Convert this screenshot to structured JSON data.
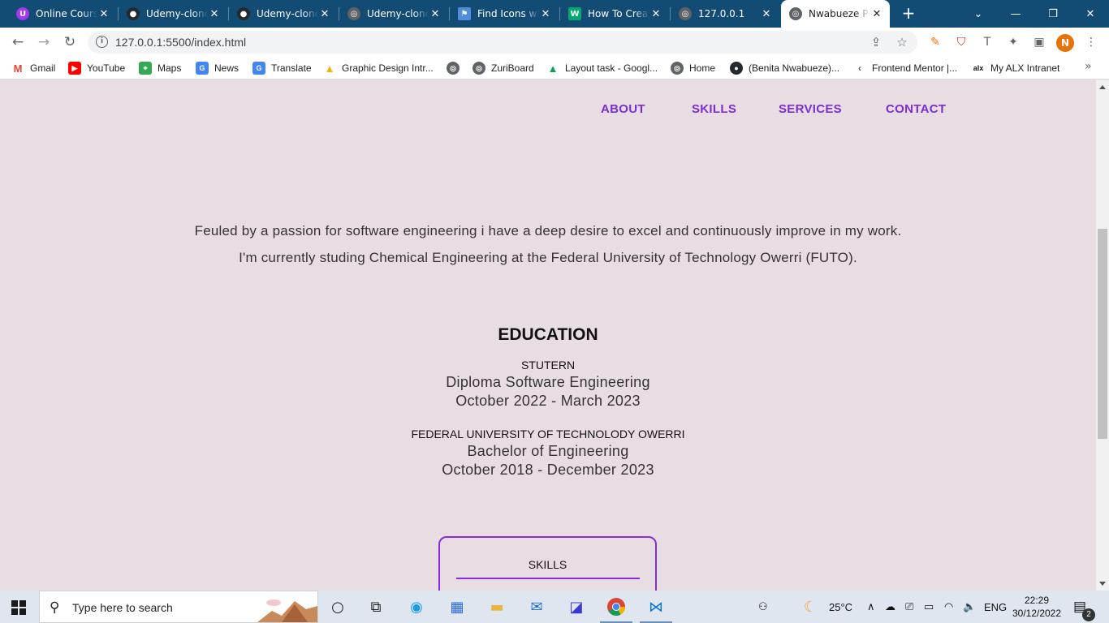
{
  "browser": {
    "tabs": [
      {
        "title": "Online Courses",
        "icon": "udemy-icon",
        "color": "#a435f0"
      },
      {
        "title": "Udemy-clone",
        "icon": "github-icon",
        "color": "#24292f"
      },
      {
        "title": "Udemy-clone",
        "icon": "github-icon",
        "color": "#24292f"
      },
      {
        "title": "Udemy-clone",
        "icon": "globe-icon",
        "color": "#5f6368"
      },
      {
        "title": "Find Icons with",
        "icon": "flag-icon",
        "color": "#528dd7"
      },
      {
        "title": "How To Create",
        "icon": "w-icon",
        "color": "#04aa6d"
      },
      {
        "title": "127.0.0.1",
        "icon": "globe-icon",
        "color": "#5f6368"
      },
      {
        "title": "Nwabueze Portfolio",
        "icon": "globe-icon",
        "color": "#5f6368",
        "active": true
      }
    ],
    "url": "127.0.0.1:5500/index.html",
    "profile_initial": "N",
    "bookmarks": [
      {
        "label": "Gmail",
        "icon": "gmail-icon"
      },
      {
        "label": "YouTube",
        "icon": "youtube-icon"
      },
      {
        "label": "Maps",
        "icon": "maps-icon"
      },
      {
        "label": "News",
        "icon": "news-icon"
      },
      {
        "label": "Translate",
        "icon": "translate-icon"
      },
      {
        "label": "Graphic Design Intr...",
        "icon": "graphic-design-icon"
      },
      {
        "label": "",
        "icon": "globe-icon"
      },
      {
        "label": "ZuriBoard",
        "icon": "globe-icon"
      },
      {
        "label": "Layout task - Googl...",
        "icon": "drive-icon"
      },
      {
        "label": "Home",
        "icon": "globe-icon"
      },
      {
        "label": "(Benita Nwabueze)...",
        "icon": "github-icon"
      },
      {
        "label": "Frontend Mentor |...",
        "icon": "frontend-mentor-icon"
      },
      {
        "label": "My ALX Intranet",
        "icon": "alx-icon"
      }
    ]
  },
  "page": {
    "nav": [
      "ABOUT",
      "SKILLS",
      "SERVICES",
      "CONTACT"
    ],
    "intro_line1": "Feuled by a passion for software engineering i have a deep desire to excel and continuously improve in my work.",
    "intro_line2": "I'm currently studing Chemical Engineering at the Federal University of Technology Owerri (FUTO).",
    "education": {
      "title": "EDUCATION",
      "entries": [
        {
          "school": "STUTERN",
          "degree": "Diploma Software Engineering",
          "period": "October 2022 - March 2023"
        },
        {
          "school": "FEDERAL UNIVERSITY OF TECHNOLODY OWERRI",
          "degree": "Bachelor of Engineering",
          "period": "October 2018 - December 2023"
        }
      ]
    },
    "skills_card_title": "SKILLS",
    "accent_color": "#7b2ed6",
    "background_color": "#e9dde4"
  },
  "taskbar": {
    "search_placeholder": "Type here to search",
    "weather": "25°C",
    "language": "ENG",
    "time": "22:29",
    "date": "30/12/2022",
    "notification_count": "2"
  }
}
